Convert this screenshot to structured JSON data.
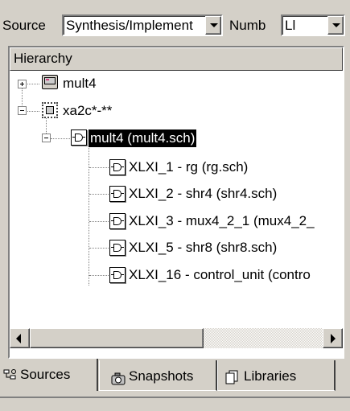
{
  "toolbar": {
    "source_label": "Source",
    "source_value": "Synthesis/Implement",
    "number_label": "Numb",
    "number_value": "Ll"
  },
  "panel": {
    "header": "Hierarchy"
  },
  "tree": {
    "items": [
      {
        "label": "mult4",
        "icon": "monitor-icon"
      },
      {
        "label": "xa2c*-**",
        "icon": "chip-icon"
      },
      {
        "label": "mult4 (mult4.sch)",
        "icon": "schematic-icon",
        "selected": true
      },
      {
        "label": "XLXI_1 - rg (rg.sch)",
        "icon": "schematic-icon"
      },
      {
        "label": "XLXI_2 - shr4 (shr4.sch)",
        "icon": "schematic-icon"
      },
      {
        "label": "XLXI_3 - mux4_2_1 (mux4_2_",
        "icon": "schematic-icon"
      },
      {
        "label": "XLXI_5 - shr8 (shr8.sch)",
        "icon": "schematic-icon"
      },
      {
        "label": "XLXI_16 - control_unit (contro",
        "icon": "schematic-icon"
      }
    ]
  },
  "tabs": [
    {
      "label": "Sources",
      "active": true
    },
    {
      "label": "Snapshots"
    },
    {
      "label": "Libraries"
    }
  ]
}
